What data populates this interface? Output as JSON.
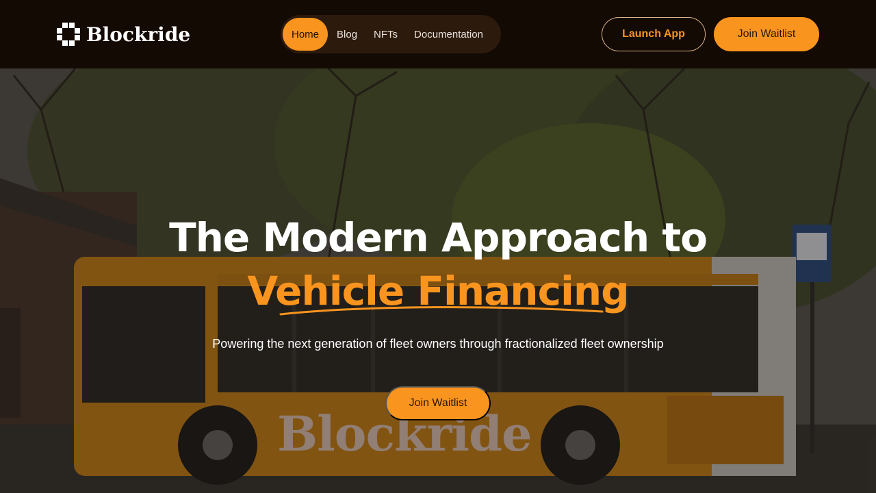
{
  "header": {
    "logo_text": "Blockride",
    "nav": [
      {
        "label": "Home",
        "active": true
      },
      {
        "label": "Blog",
        "active": false
      },
      {
        "label": "NFTs",
        "active": false
      },
      {
        "label": "Documentation",
        "active": false
      }
    ],
    "launch_label": "Launch App",
    "waitlist_label": "Join Waitlist"
  },
  "hero": {
    "title_line1": "The Modern Approach to",
    "title_line2": "Vehicle Financing",
    "subtitle": "Powering the next generation of fleet owners through fractionalized fleet ownership",
    "cta_label": "Join Waitlist",
    "bus_brand": "Blockride"
  },
  "colors": {
    "accent": "#f9941e",
    "header_bg": "#140a04",
    "nav_bg": "#2c1a0c"
  },
  "icons": {
    "logo": "pixel-cross-logo-icon"
  }
}
